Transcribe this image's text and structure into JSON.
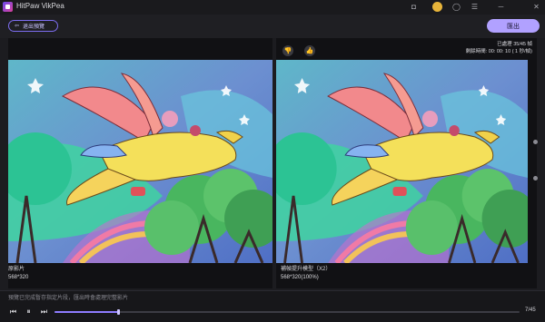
{
  "app": {
    "title": "HitPaw VikPea"
  },
  "window_controls": [
    {
      "name": "discord-icon",
      "glyph": "◘"
    },
    {
      "name": "user-avatar-icon",
      "glyph": ""
    },
    {
      "name": "account-icon",
      "glyph": "◯"
    },
    {
      "name": "menu-icon",
      "glyph": "☰"
    },
    {
      "name": "minimize-icon",
      "glyph": "─"
    },
    {
      "name": "close-icon",
      "glyph": "✕"
    }
  ],
  "toolbar": {
    "exit_preview_label": "退出預覽",
    "export_label": "匯出"
  },
  "preview": {
    "left_caption": "原影片",
    "left_size": "568*320",
    "right_caption": "補幀提升模型（X2）",
    "right_size": "568*320(100%)",
    "progress_processed": "已處理 35/45 幀",
    "progress_remaining": "剩餘時間: 00: 00: 10 ( 1 秒/幀)"
  },
  "feedback": {
    "dislike_glyph": "👎",
    "like_glyph": "👍"
  },
  "status": {
    "message": "預覽已完成暫存指定片段，匯出時會處理完整影片"
  },
  "player": {
    "prev_glyph": "⏮",
    "pause_glyph": "⏸",
    "next_glyph": "⏭",
    "frame_count": "7/45",
    "progress_fraction": 0.136
  },
  "colors": {
    "accent": "#8e7cff",
    "export_bg": "#b1a1ff"
  }
}
